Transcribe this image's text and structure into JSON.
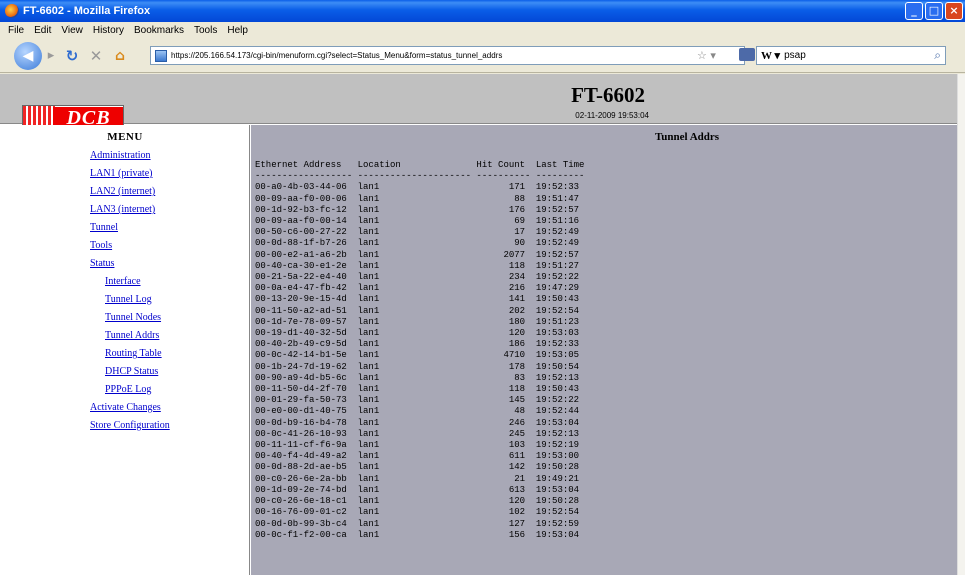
{
  "window": {
    "title": "FT-6602 - Mozilla Firefox"
  },
  "menubar": [
    "File",
    "Edit",
    "View",
    "History",
    "Bookmarks",
    "Tools",
    "Help"
  ],
  "toolbar": {
    "url": "https://205.166.54.173/cgi-bin/menuform.cgi?select=Status_Menu&form=status_tunnel_addrs",
    "search_value": "psap"
  },
  "header": {
    "logo_text": "DCB",
    "model": "FT-6602",
    "datetime": "02-11-2009 19:53:04"
  },
  "sidebar": {
    "title": "MENU",
    "items": [
      {
        "label": "Administration",
        "sub": false
      },
      {
        "label": "LAN1 (private)",
        "sub": false
      },
      {
        "label": "LAN2 (internet)",
        "sub": false
      },
      {
        "label": "LAN3 (internet)",
        "sub": false
      },
      {
        "label": "Tunnel",
        "sub": false
      },
      {
        "label": "Tools",
        "sub": false
      },
      {
        "label": "Status",
        "sub": false
      },
      {
        "label": "Interface",
        "sub": true
      },
      {
        "label": "Tunnel Log",
        "sub": true
      },
      {
        "label": "Tunnel Nodes",
        "sub": true
      },
      {
        "label": "Tunnel Addrs",
        "sub": true
      },
      {
        "label": "Routing Table",
        "sub": true
      },
      {
        "label": "DHCP Status",
        "sub": true
      },
      {
        "label": "PPPoE Log",
        "sub": true
      },
      {
        "label": "Activate Changes",
        "sub": false
      },
      {
        "label": "Store Configuration",
        "sub": false
      }
    ]
  },
  "main": {
    "title": "Tunnel Addrs",
    "columns": [
      "Ethernet Address",
      "Location",
      "Hit Count",
      "Last Time"
    ],
    "rows": [
      [
        "00-a0-4b-03-44-06",
        "lan1",
        "171",
        "19:52:33"
      ],
      [
        "00-09-aa-f0-00-06",
        "lan1",
        "88",
        "19:51:47"
      ],
      [
        "00-1d-92-b3-fc-12",
        "lan1",
        "176",
        "19:52:57"
      ],
      [
        "00-09-aa-f0-00-14",
        "lan1",
        "69",
        "19:51:16"
      ],
      [
        "00-50-c6-00-27-22",
        "lan1",
        "17",
        "19:52:49"
      ],
      [
        "00-0d-88-1f-b7-26",
        "lan1",
        "90",
        "19:52:49"
      ],
      [
        "00-00-e2-a1-a6-2b",
        "lan1",
        "2077",
        "19:52:57"
      ],
      [
        "00-40-ca-30-e1-2e",
        "lan1",
        "118",
        "19:51:27"
      ],
      [
        "00-21-5a-22-e4-40",
        "lan1",
        "234",
        "19:52:22"
      ],
      [
        "00-0a-e4-47-fb-42",
        "lan1",
        "216",
        "19:47:29"
      ],
      [
        "00-13-20-9e-15-4d",
        "lan1",
        "141",
        "19:50:43"
      ],
      [
        "00-11-50-a2-ad-51",
        "lan1",
        "202",
        "19:52:54"
      ],
      [
        "00-1d-7e-78-09-57",
        "lan1",
        "180",
        "19:51:23"
      ],
      [
        "00-19-d1-40-32-5d",
        "lan1",
        "120",
        "19:53:03"
      ],
      [
        "00-40-2b-49-c9-5d",
        "lan1",
        "186",
        "19:52:33"
      ],
      [
        "00-0c-42-14-b1-5e",
        "lan1",
        "4710",
        "19:53:05"
      ],
      [
        "00-1b-24-7d-19-62",
        "lan1",
        "178",
        "19:50:54"
      ],
      [
        "00-90-a9-4d-b5-6c",
        "lan1",
        "83",
        "19:52:13"
      ],
      [
        "00-11-50-d4-2f-70",
        "lan1",
        "118",
        "19:50:43"
      ],
      [
        "00-01-29-fa-50-73",
        "lan1",
        "145",
        "19:52:22"
      ],
      [
        "00-e0-00-d1-40-75",
        "lan1",
        "48",
        "19:52:44"
      ],
      [
        "00-0d-b9-16-b4-78",
        "lan1",
        "246",
        "19:53:04"
      ],
      [
        "00-0c-41-26-10-93",
        "lan1",
        "245",
        "19:52:13"
      ],
      [
        "00-11-11-cf-f6-9a",
        "lan1",
        "103",
        "19:52:19"
      ],
      [
        "00-40-f4-4d-49-a2",
        "lan1",
        "611",
        "19:53:00"
      ],
      [
        "00-0d-88-2d-ae-b5",
        "lan1",
        "142",
        "19:50:28"
      ],
      [
        "00-c0-26-6e-2a-bb",
        "lan1",
        "21",
        "19:49:21"
      ],
      [
        "00-1d-09-2e-74-bd",
        "lan1",
        "613",
        "19:53:04"
      ],
      [
        "00-c0-26-6e-18-c1",
        "lan1",
        "120",
        "19:50:28"
      ],
      [
        "00-16-76-09-01-c2",
        "lan1",
        "102",
        "19:52:54"
      ],
      [
        "00-0d-0b-99-3b-c4",
        "lan1",
        "127",
        "19:52:59"
      ],
      [
        "00-0c-f1-f2-00-ca",
        "lan1",
        "156",
        "19:53:04"
      ]
    ]
  }
}
